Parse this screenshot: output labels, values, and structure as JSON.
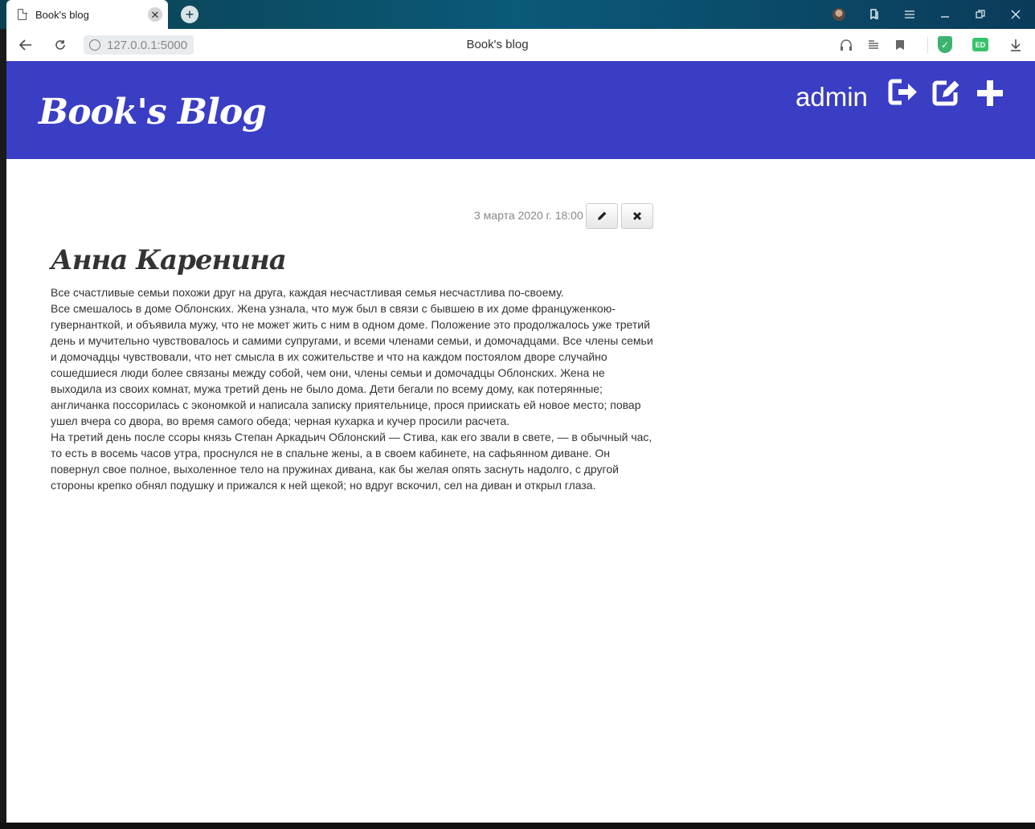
{
  "browser": {
    "tab_title": "Book's blog",
    "tab_close_glyph": "✕",
    "new_tab_glyph": "+",
    "url": "127.0.0.1:5000",
    "page_title": "Book's blog",
    "back_glyph": "←",
    "reload_glyph": "↻",
    "ext_badge": "ED",
    "shield_glyph": "✓"
  },
  "site": {
    "brand": "Book's Blog",
    "user": "admin",
    "header_color": "#3a3ec4"
  },
  "post": {
    "date": "3 марта 2020 г. 18:00",
    "title": "Анна Каренина",
    "paragraphs": [
      "Все счастливые семьи похожи друг на друга, каждая несчастливая семья несчастлива по-своему.",
      "Все смешалось в доме Облонских. Жена узнала, что муж был в связи с бывшею в их доме француженкою-гувернанткой, и объявила мужу, что не может жить с ним в одном доме. Положение это продолжалось уже третий день и мучительно чувствовалось и самими супругами, и всеми членами семьи, и домочадцами. Все члены семьи и домочадцы чувствовали, что нет смысла в их сожительстве и что на каждом постоялом дворе случайно сошедшиеся люди более связаны между собой, чем они, члены семьи и домочадцы Облонских. Жена не выходила из своих комнат, мужа третий день не было дома. Дети бегали по всему дому, как потерянные; англичанка поссорилась с экономкой и написала записку приятельнице, прося приискать ей новое место; повар ушел вчера со двора, во время самого обеда; черная кухарка и кучер просили расчета.",
      "На третий день после ссоры князь Степан Аркадьич Облонский — Стива, как его звали в свете, — в обычный час, то есть в восемь часов утра, проснулся не в спальне жены, а в своем кабинете, на сафьянном диване. Он повернул свое полное, выхоленное тело на пружинах дивана, как бы желая опять заснуть надолго, с другой стороны крепко обнял подушку и прижался к ней щекой; но вдруг вскочил, сел на диван и открыл глаза."
    ]
  }
}
